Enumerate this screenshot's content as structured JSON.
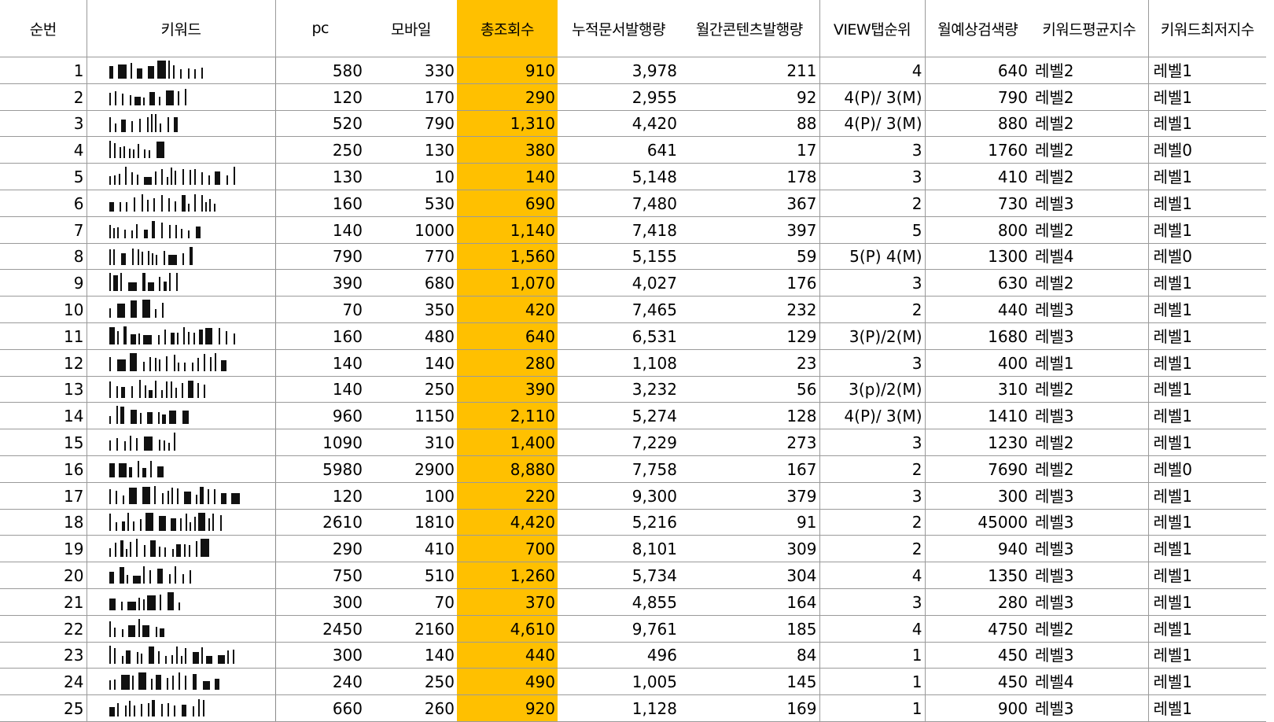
{
  "columns": [
    "순번",
    "키워드",
    "pc",
    "모바일",
    "총조회수",
    "누적문서발행량",
    "월간콘텐츠발행량",
    "VIEW탭순위",
    "월예상검색량",
    "키워드평균지수",
    "키워드최저지수"
  ],
  "colors": {
    "highlight": "#ffc000",
    "grid": "#9a9a9a"
  },
  "rows": [
    {
      "no": "1",
      "pc": "580",
      "mobile": "330",
      "total": "910",
      "cumulative": "3,978",
      "monthly": "211",
      "view_rank": "4",
      "est_search": "640",
      "avg_level": "레벨2",
      "min_level": "레벨1"
    },
    {
      "no": "2",
      "pc": "120",
      "mobile": "170",
      "total": "290",
      "cumulative": "2,955",
      "monthly": "92",
      "view_rank": "4(P)/ 3(M)",
      "est_search": "790",
      "avg_level": "레벨2",
      "min_level": "레벨1"
    },
    {
      "no": "3",
      "pc": "520",
      "mobile": "790",
      "total": "1,310",
      "cumulative": "4,420",
      "monthly": "88",
      "view_rank": "4(P)/ 3(M)",
      "est_search": "880",
      "avg_level": "레벨2",
      "min_level": "레벨1"
    },
    {
      "no": "4",
      "pc": "250",
      "mobile": "130",
      "total": "380",
      "cumulative": "641",
      "monthly": "17",
      "view_rank": "3",
      "est_search": "1760",
      "avg_level": "레벨2",
      "min_level": "레벨0"
    },
    {
      "no": "5",
      "pc": "130",
      "mobile": "10",
      "total": "140",
      "cumulative": "5,148",
      "monthly": "178",
      "view_rank": "3",
      "est_search": "410",
      "avg_level": "레벨2",
      "min_level": "레벨1"
    },
    {
      "no": "6",
      "pc": "160",
      "mobile": "530",
      "total": "690",
      "cumulative": "7,480",
      "monthly": "367",
      "view_rank": "2",
      "est_search": "730",
      "avg_level": "레벨3",
      "min_level": "레벨1"
    },
    {
      "no": "7",
      "pc": "140",
      "mobile": "1000",
      "total": "1,140",
      "cumulative": "7,418",
      "monthly": "397",
      "view_rank": "5",
      "est_search": "800",
      "avg_level": "레벨2",
      "min_level": "레벨1"
    },
    {
      "no": "8",
      "pc": "790",
      "mobile": "770",
      "total": "1,560",
      "cumulative": "5,155",
      "monthly": "59",
      "view_rank": "5(P) 4(M)",
      "est_search": "1300",
      "avg_level": "레벨4",
      "min_level": "레벨0"
    },
    {
      "no": "9",
      "pc": "390",
      "mobile": "680",
      "total": "1,070",
      "cumulative": "4,027",
      "monthly": "176",
      "view_rank": "3",
      "est_search": "630",
      "avg_level": "레벨2",
      "min_level": "레벨1"
    },
    {
      "no": "10",
      "pc": "70",
      "mobile": "350",
      "total": "420",
      "cumulative": "7,465",
      "monthly": "232",
      "view_rank": "2",
      "est_search": "440",
      "avg_level": "레벨3",
      "min_level": "레벨1"
    },
    {
      "no": "11",
      "pc": "160",
      "mobile": "480",
      "total": "640",
      "cumulative": "6,531",
      "monthly": "129",
      "view_rank": "3(P)/2(M)",
      "est_search": "1680",
      "avg_level": "레벨3",
      "min_level": "레벨1"
    },
    {
      "no": "12",
      "pc": "140",
      "mobile": "140",
      "total": "280",
      "cumulative": "1,108",
      "monthly": "23",
      "view_rank": "3",
      "est_search": "400",
      "avg_level": "레벨1",
      "min_level": "레벨1"
    },
    {
      "no": "13",
      "pc": "140",
      "mobile": "250",
      "total": "390",
      "cumulative": "3,232",
      "monthly": "56",
      "view_rank": "3(p)/2(M)",
      "est_search": "310",
      "avg_level": "레벨2",
      "min_level": "레벨1"
    },
    {
      "no": "14",
      "pc": "960",
      "mobile": "1150",
      "total": "2,110",
      "cumulative": "5,274",
      "monthly": "128",
      "view_rank": "4(P)/ 3(M)",
      "est_search": "1410",
      "avg_level": "레벨3",
      "min_level": "레벨1"
    },
    {
      "no": "15",
      "pc": "1090",
      "mobile": "310",
      "total": "1,400",
      "cumulative": "7,229",
      "monthly": "273",
      "view_rank": "3",
      "est_search": "1230",
      "avg_level": "레벨2",
      "min_level": "레벨1"
    },
    {
      "no": "16",
      "pc": "5980",
      "mobile": "2900",
      "total": "8,880",
      "cumulative": "7,758",
      "monthly": "167",
      "view_rank": "2",
      "est_search": "7690",
      "avg_level": "레벨2",
      "min_level": "레벨0"
    },
    {
      "no": "17",
      "pc": "120",
      "mobile": "100",
      "total": "220",
      "cumulative": "9,300",
      "monthly": "379",
      "view_rank": "3",
      "est_search": "300",
      "avg_level": "레벨3",
      "min_level": "레벨1"
    },
    {
      "no": "18",
      "pc": "2610",
      "mobile": "1810",
      "total": "4,420",
      "cumulative": "5,216",
      "monthly": "91",
      "view_rank": "2",
      "est_search": "45000",
      "avg_level": "레벨3",
      "min_level": "레벨1"
    },
    {
      "no": "19",
      "pc": "290",
      "mobile": "410",
      "total": "700",
      "cumulative": "8,101",
      "monthly": "309",
      "view_rank": "2",
      "est_search": "940",
      "avg_level": "레벨3",
      "min_level": "레벨1"
    },
    {
      "no": "20",
      "pc": "750",
      "mobile": "510",
      "total": "1,260",
      "cumulative": "5,734",
      "monthly": "304",
      "view_rank": "4",
      "est_search": "1350",
      "avg_level": "레벨3",
      "min_level": "레벨1"
    },
    {
      "no": "21",
      "pc": "300",
      "mobile": "70",
      "total": "370",
      "cumulative": "4,855",
      "monthly": "164",
      "view_rank": "3",
      "est_search": "280",
      "avg_level": "레벨3",
      "min_level": "레벨1"
    },
    {
      "no": "22",
      "pc": "2450",
      "mobile": "2160",
      "total": "4,610",
      "cumulative": "9,761",
      "monthly": "185",
      "view_rank": "4",
      "est_search": "4750",
      "avg_level": "레벨2",
      "min_level": "레벨1"
    },
    {
      "no": "23",
      "pc": "300",
      "mobile": "140",
      "total": "440",
      "cumulative": "496",
      "monthly": "84",
      "view_rank": "1",
      "est_search": "450",
      "avg_level": "레벨3",
      "min_level": "레벨1"
    },
    {
      "no": "24",
      "pc": "240",
      "mobile": "250",
      "total": "490",
      "cumulative": "1,005",
      "monthly": "145",
      "view_rank": "1",
      "est_search": "450",
      "avg_level": "레벨4",
      "min_level": "레벨1"
    },
    {
      "no": "25",
      "pc": "660",
      "mobile": "260",
      "total": "920",
      "cumulative": "1,128",
      "monthly": "169",
      "view_rank": "1",
      "est_search": "900",
      "avg_level": "레벨3",
      "min_level": "레벨1"
    }
  ]
}
